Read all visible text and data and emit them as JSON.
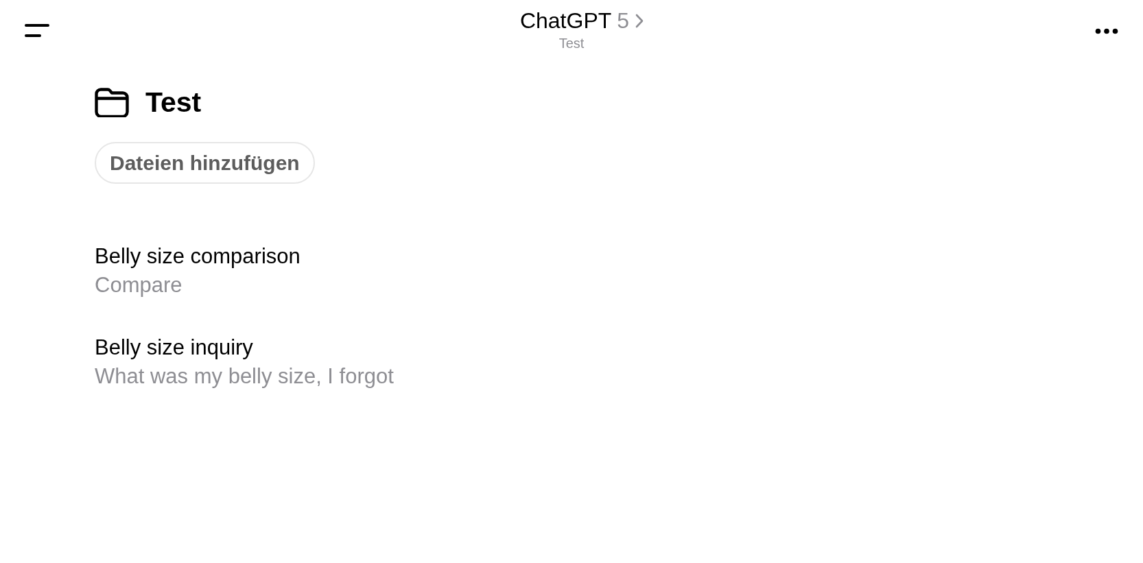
{
  "header": {
    "title": "ChatGPT",
    "model": "5",
    "subtitle": "Test"
  },
  "project": {
    "title": "Test",
    "add_files_button": "Dateien hinzufügen"
  },
  "chats": [
    {
      "title": "Belly size comparison",
      "preview": "Compare"
    },
    {
      "title": "Belly size inquiry",
      "preview": "What was my belly size, I forgot"
    }
  ]
}
